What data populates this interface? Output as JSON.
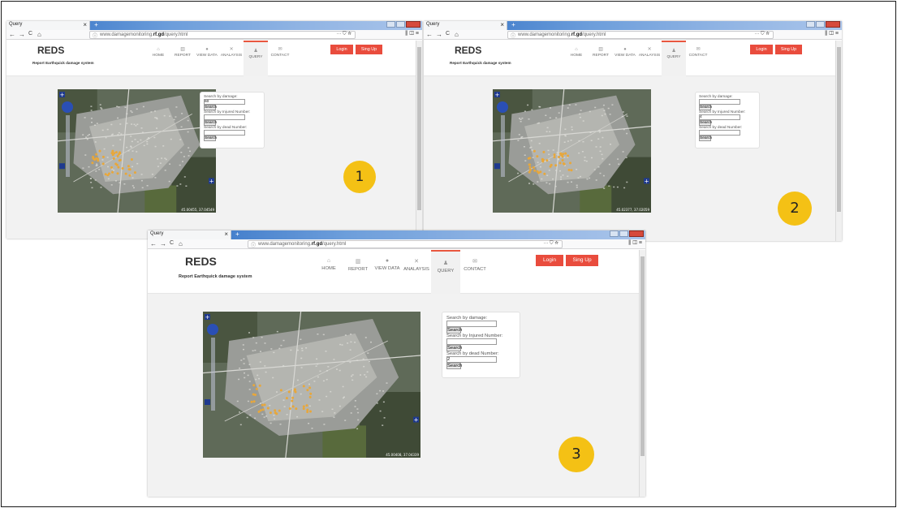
{
  "tab_title": "Query",
  "tab_close": "×",
  "new_tab": "+",
  "url": {
    "prefix": "www.damagemonitoring.",
    "domain": "rf.gd",
    "path": "/query.html"
  },
  "url_tools": "··· ⛉ ☆",
  "right_tools": "⫼ ◫ ≡",
  "nav": {
    "back": "←",
    "forward": "→",
    "reload": "C",
    "home": "⌂"
  },
  "site": {
    "logo": "REDS",
    "tagline": "Report Earthquick damage system"
  },
  "menu": [
    {
      "label": "HOME",
      "icon": "home-icon",
      "glyph": "⌂"
    },
    {
      "label": "REPORT",
      "icon": "bank-icon",
      "glyph": "▥"
    },
    {
      "label": "VIEW DATA",
      "icon": "comment-icon",
      "glyph": "●"
    },
    {
      "label": "ANALAYSIS",
      "icon": "tools-icon",
      "glyph": "✕"
    },
    {
      "label": "QUERY",
      "icon": "person-icon",
      "glyph": "♟"
    },
    {
      "label": "CONTACT",
      "icon": "mail-icon",
      "glyph": "✉"
    }
  ],
  "auth": {
    "login": "Login",
    "signup": "Sing Up"
  },
  "panel": {
    "damage_label": "Search by damage:",
    "injured_label": "Search by Injured Number:",
    "dead_label": "Search by dead Number:",
    "search": "Search"
  },
  "windows": [
    {
      "badge": "1",
      "damage_value": "60",
      "injured_value": "",
      "dead_value": "",
      "coords": "45.00455, 37.04549"
    },
    {
      "badge": "2",
      "damage_value": "",
      "injured_value": "4",
      "dead_value": "",
      "coords": "45.02377, 37.02059"
    },
    {
      "badge": "3",
      "damage_value": "",
      "injured_value": "",
      "dead_value": "2",
      "coords": "45.00408, 37.04339"
    }
  ],
  "colors": {
    "accent": "#e94c3d",
    "badge": "#f4c115",
    "titlebar": "#2a6bc2"
  }
}
